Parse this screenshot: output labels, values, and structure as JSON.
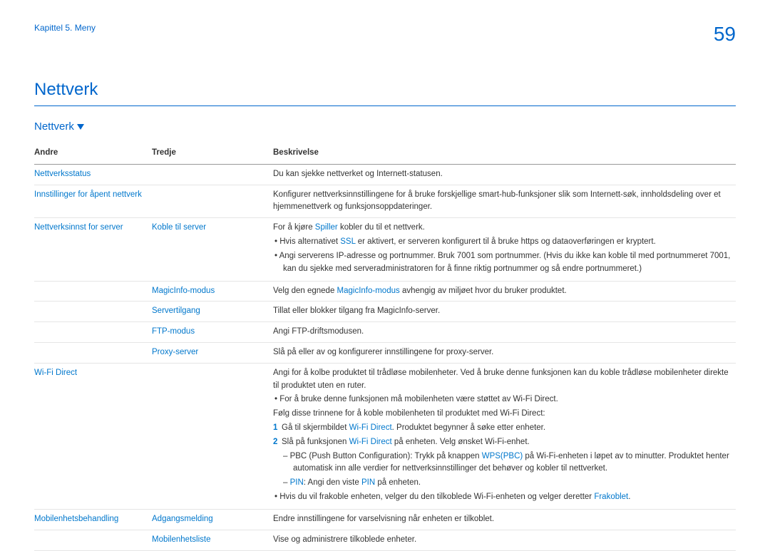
{
  "chapter": "Kapittel 5. Meny",
  "page_number": "59",
  "title": "Nettverk",
  "subtitle": "Nettverk",
  "headers": {
    "andre": "Andre",
    "tredje": "Tredje",
    "beskrivelse": "Beskrivelse"
  },
  "rows": {
    "r0": {
      "andre": "Nettverksstatus",
      "desc": "Du kan sjekke nettverket og Internett-statusen."
    },
    "r1": {
      "andre": "Innstillinger for åpent nettverk",
      "desc": "Konfigurer nettverksinnstillingene for å bruke forskjellige smart-hub-funksjoner slik som Internett-søk, innholdsdeling over et hjemmenettverk og funksjonsoppdateringer."
    },
    "r2": {
      "andre": "Nettverksinnst for server",
      "tredje": "Koble til server",
      "desc_pre": "For å kjøre ",
      "desc_link": "Spiller",
      "desc_post": " kobler du til et nettverk.",
      "b1_pre": "Hvis alternativet ",
      "b1_link": "SSL",
      "b1_post": " er aktivert, er serveren konfigurert til å bruke https og dataoverføringen er kryptert.",
      "b2": "Angi serverens IP-adresse og portnummer. Bruk 7001 som portnummer. (Hvis du ikke kan koble til med portnummeret 7001, kan du sjekke med serveradministratoren for å finne riktig portnummer og så endre portnummeret.)"
    },
    "r3": {
      "tredje": "MagicInfo-modus",
      "desc_pre": "Velg den egnede ",
      "desc_link": "MagicInfo-modus",
      "desc_post": " avhengig av miljøet hvor du bruker produktet."
    },
    "r4": {
      "tredje": "Servertilgang",
      "desc": "Tillat eller blokker tilgang fra MagicInfo-server."
    },
    "r5": {
      "tredje": "FTP-modus",
      "desc": "Angi FTP-driftsmodusen."
    },
    "r6": {
      "tredje": "Proxy-server",
      "desc": "Slå på eller av og konfigurerer innstillingene for proxy-server."
    },
    "r7": {
      "andre": "Wi-Fi Direct",
      "p1": "Angi for å kolbe produktet til trådløse mobilenheter. Ved å bruke denne funksjonen kan du koble trådløse mobilenheter direkte til produktet uten en ruter.",
      "b1": "For å bruke denne funksjonen må mobilenheten være støttet av Wi-Fi Direct.",
      "p2": "Følg disse trinnene for å koble mobilenheten til produktet med Wi-Fi Direct:",
      "n1_pre": "Gå til skjermbildet ",
      "n1_link": "Wi-Fi Direct",
      "n1_post": ". Produktet begynner å søke etter enheter.",
      "n2_pre": "Slå på funksjonen ",
      "n2_link": "Wi-Fi Direct",
      "n2_post": " på enheten. Velg ønsket Wi-Fi-enhet.",
      "d1_pre": "PBC (Push Button Configuration): Trykk på knappen ",
      "d1_link": "WPS(PBC)",
      "d1_post": " på Wi-Fi-enheten i løpet av to minutter. Produktet henter automatisk inn alle verdier for nettverksinnstillinger det behøver og kobler til nettverket.",
      "d2_link1": "PIN",
      "d2_mid": ": Angi den viste ",
      "d2_link2": "PIN",
      "d2_post": " på enheten.",
      "b2_pre": "Hvis du vil frakoble enheten, velger du den tilkoblede Wi-Fi-enheten og velger deretter ",
      "b2_link": "Frakoblet",
      "b2_post": "."
    },
    "r8": {
      "andre": "Mobilenhetsbehandling",
      "tredje": "Adgangsmelding",
      "desc": "Endre innstillingene for varselvisning når enheten er tilkoblet."
    },
    "r9": {
      "tredje": "Mobilenhetsliste",
      "desc": "Vise og administrere tilkoblede enheter."
    }
  }
}
